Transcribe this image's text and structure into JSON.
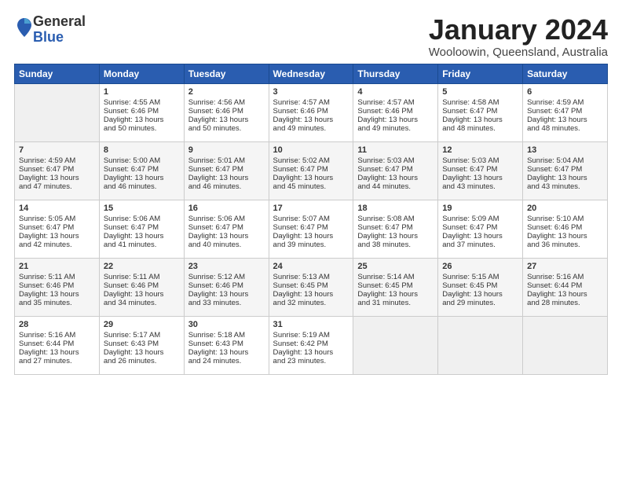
{
  "header": {
    "logo_general": "General",
    "logo_blue": "Blue",
    "month_title": "January 2024",
    "location": "Wooloowin, Queensland, Australia"
  },
  "days_of_week": [
    "Sunday",
    "Monday",
    "Tuesday",
    "Wednesday",
    "Thursday",
    "Friday",
    "Saturday"
  ],
  "weeks": [
    [
      {
        "day": "",
        "content": ""
      },
      {
        "day": "1",
        "content": "Sunrise: 4:55 AM\nSunset: 6:46 PM\nDaylight: 13 hours\nand 50 minutes."
      },
      {
        "day": "2",
        "content": "Sunrise: 4:56 AM\nSunset: 6:46 PM\nDaylight: 13 hours\nand 50 minutes."
      },
      {
        "day": "3",
        "content": "Sunrise: 4:57 AM\nSunset: 6:46 PM\nDaylight: 13 hours\nand 49 minutes."
      },
      {
        "day": "4",
        "content": "Sunrise: 4:57 AM\nSunset: 6:46 PM\nDaylight: 13 hours\nand 49 minutes."
      },
      {
        "day": "5",
        "content": "Sunrise: 4:58 AM\nSunset: 6:47 PM\nDaylight: 13 hours\nand 48 minutes."
      },
      {
        "day": "6",
        "content": "Sunrise: 4:59 AM\nSunset: 6:47 PM\nDaylight: 13 hours\nand 48 minutes."
      }
    ],
    [
      {
        "day": "7",
        "content": "Sunrise: 4:59 AM\nSunset: 6:47 PM\nDaylight: 13 hours\nand 47 minutes."
      },
      {
        "day": "8",
        "content": "Sunrise: 5:00 AM\nSunset: 6:47 PM\nDaylight: 13 hours\nand 46 minutes."
      },
      {
        "day": "9",
        "content": "Sunrise: 5:01 AM\nSunset: 6:47 PM\nDaylight: 13 hours\nand 46 minutes."
      },
      {
        "day": "10",
        "content": "Sunrise: 5:02 AM\nSunset: 6:47 PM\nDaylight: 13 hours\nand 45 minutes."
      },
      {
        "day": "11",
        "content": "Sunrise: 5:03 AM\nSunset: 6:47 PM\nDaylight: 13 hours\nand 44 minutes."
      },
      {
        "day": "12",
        "content": "Sunrise: 5:03 AM\nSunset: 6:47 PM\nDaylight: 13 hours\nand 43 minutes."
      },
      {
        "day": "13",
        "content": "Sunrise: 5:04 AM\nSunset: 6:47 PM\nDaylight: 13 hours\nand 43 minutes."
      }
    ],
    [
      {
        "day": "14",
        "content": "Sunrise: 5:05 AM\nSunset: 6:47 PM\nDaylight: 13 hours\nand 42 minutes."
      },
      {
        "day": "15",
        "content": "Sunrise: 5:06 AM\nSunset: 6:47 PM\nDaylight: 13 hours\nand 41 minutes."
      },
      {
        "day": "16",
        "content": "Sunrise: 5:06 AM\nSunset: 6:47 PM\nDaylight: 13 hours\nand 40 minutes."
      },
      {
        "day": "17",
        "content": "Sunrise: 5:07 AM\nSunset: 6:47 PM\nDaylight: 13 hours\nand 39 minutes."
      },
      {
        "day": "18",
        "content": "Sunrise: 5:08 AM\nSunset: 6:47 PM\nDaylight: 13 hours\nand 38 minutes."
      },
      {
        "day": "19",
        "content": "Sunrise: 5:09 AM\nSunset: 6:47 PM\nDaylight: 13 hours\nand 37 minutes."
      },
      {
        "day": "20",
        "content": "Sunrise: 5:10 AM\nSunset: 6:46 PM\nDaylight: 13 hours\nand 36 minutes."
      }
    ],
    [
      {
        "day": "21",
        "content": "Sunrise: 5:11 AM\nSunset: 6:46 PM\nDaylight: 13 hours\nand 35 minutes."
      },
      {
        "day": "22",
        "content": "Sunrise: 5:11 AM\nSunset: 6:46 PM\nDaylight: 13 hours\nand 34 minutes."
      },
      {
        "day": "23",
        "content": "Sunrise: 5:12 AM\nSunset: 6:46 PM\nDaylight: 13 hours\nand 33 minutes."
      },
      {
        "day": "24",
        "content": "Sunrise: 5:13 AM\nSunset: 6:45 PM\nDaylight: 13 hours\nand 32 minutes."
      },
      {
        "day": "25",
        "content": "Sunrise: 5:14 AM\nSunset: 6:45 PM\nDaylight: 13 hours\nand 31 minutes."
      },
      {
        "day": "26",
        "content": "Sunrise: 5:15 AM\nSunset: 6:45 PM\nDaylight: 13 hours\nand 29 minutes."
      },
      {
        "day": "27",
        "content": "Sunrise: 5:16 AM\nSunset: 6:44 PM\nDaylight: 13 hours\nand 28 minutes."
      }
    ],
    [
      {
        "day": "28",
        "content": "Sunrise: 5:16 AM\nSunset: 6:44 PM\nDaylight: 13 hours\nand 27 minutes."
      },
      {
        "day": "29",
        "content": "Sunrise: 5:17 AM\nSunset: 6:43 PM\nDaylight: 13 hours\nand 26 minutes."
      },
      {
        "day": "30",
        "content": "Sunrise: 5:18 AM\nSunset: 6:43 PM\nDaylight: 13 hours\nand 24 minutes."
      },
      {
        "day": "31",
        "content": "Sunrise: 5:19 AM\nSunset: 6:42 PM\nDaylight: 13 hours\nand 23 minutes."
      },
      {
        "day": "",
        "content": ""
      },
      {
        "day": "",
        "content": ""
      },
      {
        "day": "",
        "content": ""
      }
    ]
  ]
}
